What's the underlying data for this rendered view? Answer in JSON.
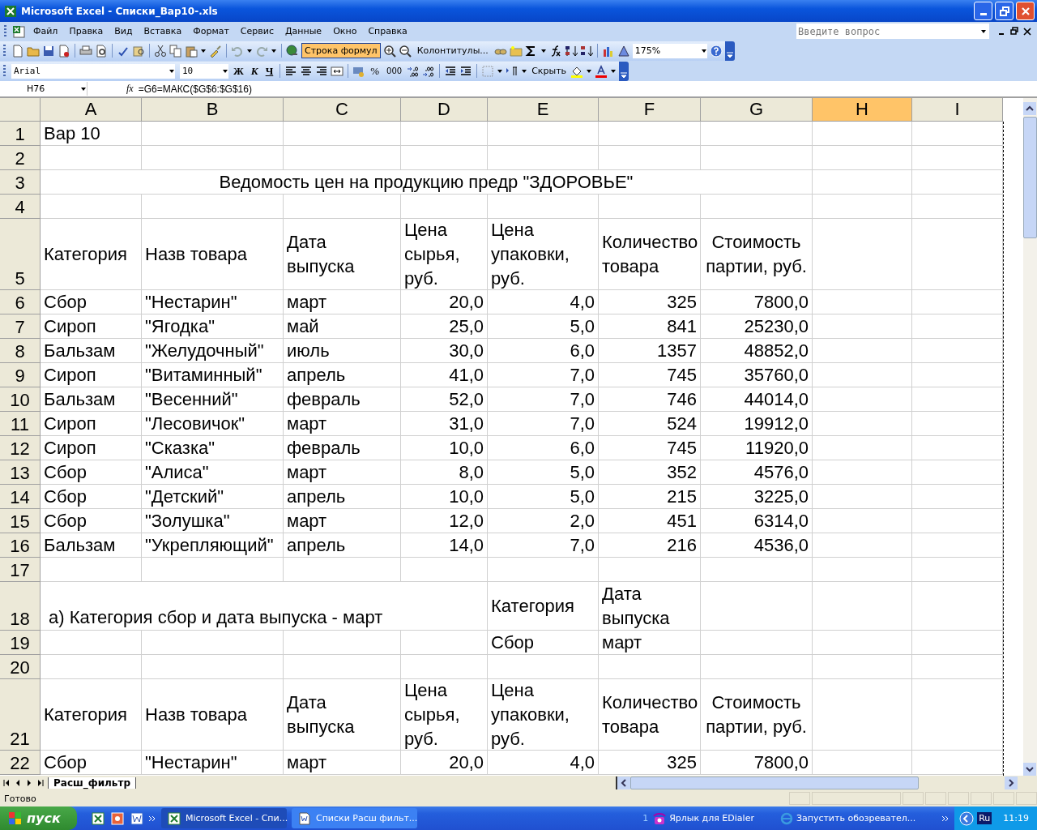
{
  "window": {
    "title": "Microsoft Excel - Списки_Вар10-.xls"
  },
  "menu": [
    "Файл",
    "Правка",
    "Вид",
    "Вставка",
    "Формат",
    "Сервис",
    "Данные",
    "Окно",
    "Справка"
  ],
  "help_box": {
    "placeholder": "Введите вопрос"
  },
  "standard_toolbar": {
    "formula_bar_button": {
      "label": "Строка формул",
      "on": true
    },
    "headers_button": "Колонтитулы...",
    "zoom": "175%"
  },
  "formatting_toolbar": {
    "font": "Arial",
    "size": "10",
    "bold": "Ж",
    "italic": "К",
    "underline": "Ч",
    "percent": "%",
    "thousands": "000",
    "hide_button": "Скрыть"
  },
  "formula_bar": {
    "name_box": "H76",
    "fx_label": "fx",
    "formula": "=G6=МАКС($G$6:$G$16)"
  },
  "columns": [
    {
      "label": "A",
      "selected": false
    },
    {
      "label": "B",
      "selected": false
    },
    {
      "label": "C",
      "selected": false
    },
    {
      "label": "D",
      "selected": false
    },
    {
      "label": "E",
      "selected": false
    },
    {
      "label": "F",
      "selected": false
    },
    {
      "label": "G",
      "selected": false
    },
    {
      "label": "H",
      "selected": true
    },
    {
      "label": "I",
      "selected": false
    }
  ],
  "rows": [
    {
      "number": "1",
      "kind": "normal",
      "cells": [
        {
          "text": "Вар 10"
        },
        null,
        null,
        null,
        null,
        null,
        null,
        null,
        null
      ]
    },
    {
      "number": "2",
      "kind": "normal",
      "cells": [
        null,
        null,
        null,
        null,
        null,
        null,
        null,
        null,
        null
      ]
    },
    {
      "number": "3",
      "kind": "normal",
      "cells": [
        {
          "text": "Ведомость цен на продукцию предр \"ЗДОРОВЬЕ\"",
          "kind": "centered"
        },
        {
          "joined": true
        },
        {
          "joined": true
        },
        {
          "joined": true
        },
        {
          "joined": true
        },
        {
          "joined": true
        },
        {
          "joined": true
        },
        null,
        null
      ]
    },
    {
      "number": "4",
      "kind": "normal",
      "cells": [
        null,
        null,
        null,
        null,
        null,
        null,
        null,
        null,
        null
      ]
    },
    {
      "number": "5",
      "kind": "header",
      "cells": [
        {
          "text": "Категория"
        },
        {
          "text": "Назв товара"
        },
        {
          "text": "Дата выпуска"
        },
        {
          "text": "Цена сырья, руб."
        },
        {
          "text": "Цена упаковки, руб."
        },
        {
          "text": "Количество товара"
        },
        {
          "text": "Стоимость партии, руб.",
          "kind": "centered"
        },
        null,
        null
      ]
    },
    {
      "number": "6",
      "kind": "normal",
      "cells": [
        {
          "text": "Сбор"
        },
        {
          "text": "\"Нестарин\""
        },
        {
          "text": "март"
        },
        {
          "text": "20,0",
          "kind": "number"
        },
        {
          "text": "4,0",
          "kind": "number"
        },
        {
          "text": "325",
          "kind": "number"
        },
        {
          "text": "7800,0",
          "kind": "number"
        },
        null,
        null
      ]
    },
    {
      "number": "7",
      "kind": "normal",
      "cells": [
        {
          "text": "Сироп"
        },
        {
          "text": "\"Ягодка\""
        },
        {
          "text": "май"
        },
        {
          "text": "25,0",
          "kind": "number"
        },
        {
          "text": "5,0",
          "kind": "number"
        },
        {
          "text": "841",
          "kind": "number"
        },
        {
          "text": "25230,0",
          "kind": "number"
        },
        null,
        null
      ]
    },
    {
      "number": "8",
      "kind": "normal",
      "cells": [
        {
          "text": "Бальзам"
        },
        {
          "text": "\"Желудочный\""
        },
        {
          "text": "июль"
        },
        {
          "text": "30,0",
          "kind": "number"
        },
        {
          "text": "6,0",
          "kind": "number"
        },
        {
          "text": "1357",
          "kind": "number"
        },
        {
          "text": "48852,0",
          "kind": "number"
        },
        null,
        null
      ]
    },
    {
      "number": "9",
      "kind": "normal",
      "cells": [
        {
          "text": "Сироп"
        },
        {
          "text": "\"Витаминный\""
        },
        {
          "text": "апрель"
        },
        {
          "text": "41,0",
          "kind": "number"
        },
        {
          "text": "7,0",
          "kind": "number"
        },
        {
          "text": "745",
          "kind": "number"
        },
        {
          "text": "35760,0",
          "kind": "number"
        },
        null,
        null
      ]
    },
    {
      "number": "10",
      "kind": "normal",
      "cells": [
        {
          "text": "Бальзам"
        },
        {
          "text": "\"Весенний\""
        },
        {
          "text": "февраль"
        },
        {
          "text": "52,0",
          "kind": "number"
        },
        {
          "text": "7,0",
          "kind": "number"
        },
        {
          "text": "746",
          "kind": "number"
        },
        {
          "text": "44014,0",
          "kind": "number"
        },
        null,
        null
      ]
    },
    {
      "number": "11",
      "kind": "normal",
      "cells": [
        {
          "text": "Сироп"
        },
        {
          "text": "\"Лесовичок\""
        },
        {
          "text": "март"
        },
        {
          "text": "31,0",
          "kind": "number"
        },
        {
          "text": "7,0",
          "kind": "number"
        },
        {
          "text": "524",
          "kind": "number"
        },
        {
          "text": "19912,0",
          "kind": "number"
        },
        null,
        null
      ]
    },
    {
      "number": "12",
      "kind": "normal",
      "cells": [
        {
          "text": "Сироп"
        },
        {
          "text": "\"Сказка\""
        },
        {
          "text": "февраль"
        },
        {
          "text": "10,0",
          "kind": "number"
        },
        {
          "text": "6,0",
          "kind": "number"
        },
        {
          "text": "745",
          "kind": "number"
        },
        {
          "text": "11920,0",
          "kind": "number"
        },
        null,
        null
      ]
    },
    {
      "number": "13",
      "kind": "normal",
      "cells": [
        {
          "text": "Сбор"
        },
        {
          "text": "\"Алиса\""
        },
        {
          "text": "март"
        },
        {
          "text": "8,0",
          "kind": "number"
        },
        {
          "text": "5,0",
          "kind": "number"
        },
        {
          "text": "352",
          "kind": "number"
        },
        {
          "text": "4576,0",
          "kind": "number"
        },
        null,
        null
      ]
    },
    {
      "number": "14",
      "kind": "normal",
      "cells": [
        {
          "text": "Сбор"
        },
        {
          "text": "\"Детский\""
        },
        {
          "text": "апрель"
        },
        {
          "text": "10,0",
          "kind": "number"
        },
        {
          "text": "5,0",
          "kind": "number"
        },
        {
          "text": "215",
          "kind": "number"
        },
        {
          "text": "3225,0",
          "kind": "number"
        },
        null,
        null
      ]
    },
    {
      "number": "15",
      "kind": "normal",
      "cells": [
        {
          "text": "Сбор"
        },
        {
          "text": "\"Золушка\""
        },
        {
          "text": "март"
        },
        {
          "text": "12,0",
          "kind": "number"
        },
        {
          "text": "2,0",
          "kind": "number"
        },
        {
          "text": "451",
          "kind": "number"
        },
        {
          "text": "6314,0",
          "kind": "number"
        },
        null,
        null
      ]
    },
    {
      "number": "16",
      "kind": "normal",
      "cells": [
        {
          "text": "Бальзам"
        },
        {
          "text": "\"Укрепляющий\""
        },
        {
          "text": "апрель"
        },
        {
          "text": "14,0",
          "kind": "number"
        },
        {
          "text": "7,0",
          "kind": "number"
        },
        {
          "text": "216",
          "kind": "number"
        },
        {
          "text": "4536,0",
          "kind": "number"
        },
        null,
        null
      ]
    },
    {
      "number": "17",
      "kind": "normal",
      "cells": [
        null,
        null,
        null,
        null,
        null,
        null,
        null,
        null,
        null
      ]
    },
    {
      "number": "18",
      "kind": "double",
      "cells": [
        {
          "text": "а) Категория сбор и дата выпуска - март",
          "kind": "caption"
        },
        {
          "joined": true
        },
        {
          "joined": true
        },
        {
          "joined": true
        },
        {
          "text": "Категория"
        },
        {
          "text": "Дата выпуска"
        },
        null,
        null,
        null
      ]
    },
    {
      "number": "19",
      "kind": "normal",
      "cells": [
        null,
        null,
        null,
        null,
        {
          "text": "Сбор"
        },
        {
          "text": "март"
        },
        null,
        null,
        null
      ]
    },
    {
      "number": "20",
      "kind": "normal",
      "cells": [
        null,
        null,
        null,
        null,
        null,
        null,
        null,
        null,
        null
      ]
    },
    {
      "number": "21",
      "kind": "header",
      "cells": [
        {
          "text": "Категория"
        },
        {
          "text": "Назв товара"
        },
        {
          "text": "Дата выпуска"
        },
        {
          "text": "Цена сырья, руб."
        },
        {
          "text": "Цена упаковки, руб."
        },
        {
          "text": "Количество товара"
        },
        {
          "text": "Стоимость партии, руб.",
          "kind": "centered"
        },
        null,
        null
      ]
    },
    {
      "number": "22",
      "kind": "normal",
      "cells": [
        {
          "text": "Сбор"
        },
        {
          "text": "\"Нестарин\""
        },
        {
          "text": "март"
        },
        {
          "text": "20,0",
          "kind": "number"
        },
        {
          "text": "4,0",
          "kind": "number"
        },
        {
          "text": "325",
          "kind": "number"
        },
        {
          "text": "7800,0",
          "kind": "number"
        },
        null,
        null
      ]
    }
  ],
  "sheet_tabs": [
    {
      "label": "Расш_фильтр",
      "selected": true
    }
  ],
  "status_bar": {
    "text": "Готово"
  },
  "taskbar": {
    "start": "пуск",
    "tasks": [
      {
        "label": "Microsoft Excel - Спи...",
        "selected": true
      },
      {
        "label": "Списки Расш фильт...",
        "selected": false
      }
    ],
    "tray": {
      "count": "1",
      "dialer": "Ярлык для EDialer",
      "browser": "Запустить обозревател...",
      "language": "Ru",
      "clock": "11:19"
    }
  }
}
